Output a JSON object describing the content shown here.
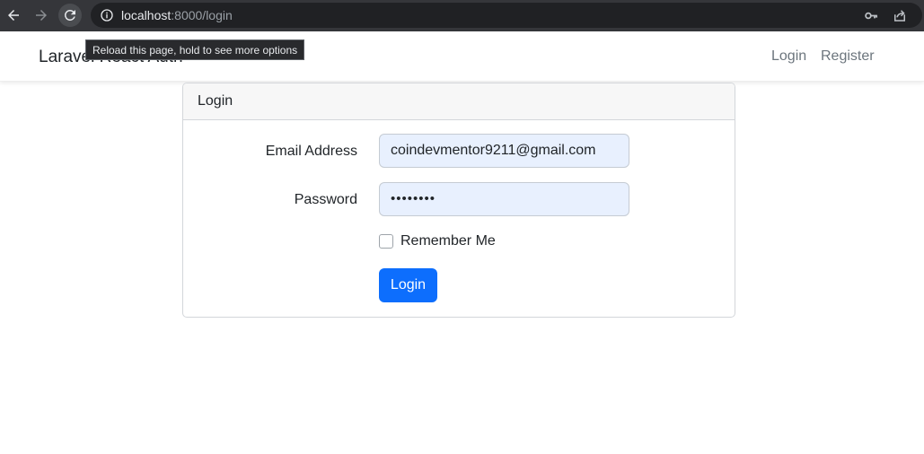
{
  "browser": {
    "url_host": "localhost",
    "url_path": ":8000/login",
    "tooltip": "Reload this page, hold to see more options",
    "icons": [
      "back-arrow-icon",
      "forward-arrow-icon",
      "reload-icon",
      "info-icon",
      "key-icon",
      "share-icon"
    ]
  },
  "navbar": {
    "brand": "Laravel React Auth",
    "links": [
      "Login",
      "Register"
    ]
  },
  "card": {
    "header": "Login",
    "email_label": "Email Address",
    "email_value": "coindevmentor9211@gmail.com",
    "password_label": "Password",
    "password_value": "••••••••",
    "remember_label": "Remember Me",
    "remember_checked": false,
    "submit_label": "Login"
  },
  "colors": {
    "primary": "#0d6efd",
    "autofill_bg": "#e8f0fe",
    "chrome_bg": "#35363a"
  }
}
